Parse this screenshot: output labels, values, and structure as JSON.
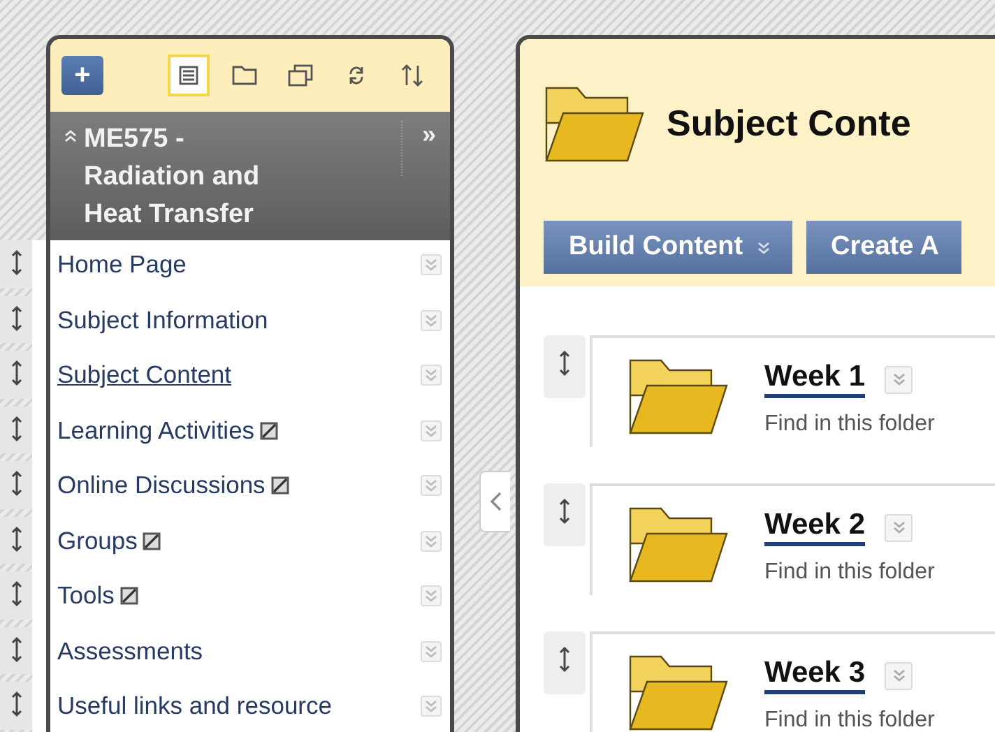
{
  "toolbar": {
    "add_button": "+",
    "views": [
      {
        "kind": "list",
        "selected": true
      },
      {
        "kind": "folder",
        "selected": false
      },
      {
        "kind": "windows",
        "selected": false
      },
      {
        "kind": "refresh",
        "selected": false
      },
      {
        "kind": "sort",
        "selected": false
      }
    ]
  },
  "course": {
    "collapse_mark": "»",
    "title": "ME575 - Radiation and Heat Transfer"
  },
  "menu": [
    {
      "label": "Home Page",
      "selected": false,
      "hidden": false
    },
    {
      "label": "Subject Information",
      "selected": false,
      "hidden": false
    },
    {
      "label": "Subject Content",
      "selected": true,
      "hidden": false
    },
    {
      "label": "Learning Activities",
      "selected": false,
      "hidden": true
    },
    {
      "label": "Online Discussions",
      "selected": false,
      "hidden": true
    },
    {
      "label": "Groups",
      "selected": false,
      "hidden": true
    },
    {
      "label": "Tools",
      "selected": false,
      "hidden": true
    },
    {
      "label": "Assessments",
      "selected": false,
      "hidden": false
    },
    {
      "label": "Useful links and resource",
      "selected": false,
      "hidden": false
    }
  ],
  "page": {
    "title": "Subject Conte",
    "buttons": [
      {
        "label": "Build Content",
        "menu": true
      },
      {
        "label": "Create A",
        "menu": false
      }
    ],
    "items": [
      {
        "title": "Week 1",
        "description": "Find in this folder"
      },
      {
        "title": "Week 2",
        "description": "Find in this folder"
      },
      {
        "title": "Week 3",
        "description": "Find in this folder"
      }
    ]
  }
}
